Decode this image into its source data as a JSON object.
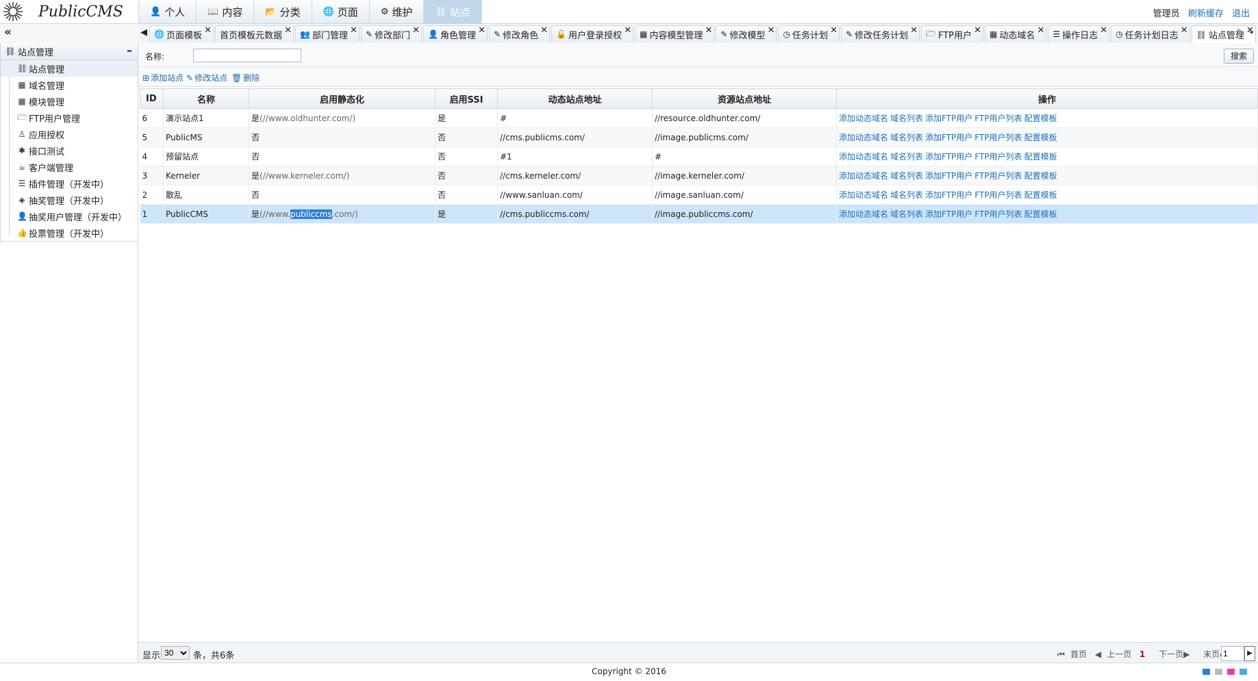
{
  "app": {
    "title": "PublicCMS"
  },
  "topnav": [
    {
      "label": "个人",
      "icon": "user-icon",
      "glyph": "👤"
    },
    {
      "label": "内容",
      "icon": "book-icon",
      "glyph": "📖"
    },
    {
      "label": "分类",
      "icon": "folder-open-icon",
      "glyph": "📂"
    },
    {
      "label": "页面",
      "icon": "globe-icon",
      "glyph": "🌐"
    },
    {
      "label": "维护",
      "icon": "gear-icon",
      "glyph": "⚙"
    },
    {
      "label": "站点",
      "icon": "sitemap-icon",
      "glyph": "⛓"
    }
  ],
  "userbar": {
    "user": "管理员",
    "refresh": "刷新缓存",
    "logout": "退出"
  },
  "sidebar": {
    "collapse": "«",
    "group": "站点管理",
    "items": [
      {
        "label": "站点管理",
        "icon": "sitemap-icon",
        "glyph": "⛓"
      },
      {
        "label": "域名管理",
        "icon": "qrcode-icon",
        "glyph": "▦"
      },
      {
        "label": "模块管理",
        "icon": "grid-icon",
        "glyph": "▦"
      },
      {
        "label": "FTP用户管理",
        "icon": "folder-icon",
        "glyph": "🗁"
      },
      {
        "label": "应用授权",
        "icon": "linux-icon",
        "glyph": "♙"
      },
      {
        "label": "接口测试",
        "icon": "bug-icon",
        "glyph": "✱"
      },
      {
        "label": "客户端管理",
        "icon": "coffee-icon",
        "glyph": "☕"
      },
      {
        "label": "插件管理（开发中）",
        "icon": "list-icon",
        "glyph": "☰"
      },
      {
        "label": "抽奖管理（开发中）",
        "icon": "ticket-icon",
        "glyph": "◈"
      },
      {
        "label": "抽奖用户管理（开发中）",
        "icon": "user-icon",
        "glyph": "👤"
      },
      {
        "label": "投票管理（开发中）",
        "icon": "thumbs-up-icon",
        "glyph": "👍"
      }
    ]
  },
  "tabs": [
    {
      "label": "页面模板",
      "icon": "globe-icon",
      "glyph": "🌐"
    },
    {
      "label": "首页模板元数据",
      "icon": "",
      "glyph": ""
    },
    {
      "label": "部门管理",
      "icon": "users-icon",
      "glyph": "👥"
    },
    {
      "label": "修改部门",
      "icon": "edit-icon",
      "glyph": "✎"
    },
    {
      "label": "角色管理",
      "icon": "user-secret-icon",
      "glyph": "👤"
    },
    {
      "label": "修改角色",
      "icon": "edit-icon",
      "glyph": "✎"
    },
    {
      "label": "用户登录授权",
      "icon": "unlock-icon",
      "glyph": "🔓"
    },
    {
      "label": "内容模型管理",
      "icon": "th-large-icon",
      "glyph": "▦"
    },
    {
      "label": "修改模型",
      "icon": "edit-icon",
      "glyph": "✎"
    },
    {
      "label": "任务计划",
      "icon": "clock-icon",
      "glyph": "◷"
    },
    {
      "label": "修改任务计划",
      "icon": "edit-icon",
      "glyph": "✎"
    },
    {
      "label": "FTP用户",
      "icon": "folder-icon",
      "glyph": "🗁"
    },
    {
      "label": "动态域名",
      "icon": "qrcode-icon",
      "glyph": "▦"
    },
    {
      "label": "操作日志",
      "icon": "list-alt-icon",
      "glyph": "☰"
    },
    {
      "label": "任务计划日志",
      "icon": "clock-icon",
      "glyph": "◷"
    },
    {
      "label": "站点管理",
      "icon": "sitemap-icon",
      "glyph": "⛓"
    }
  ],
  "search": {
    "label": "名称:",
    "value": "",
    "button": "搜索"
  },
  "toolbar": {
    "add": "添加站点",
    "edit": "修改站点",
    "delete": "删除"
  },
  "table": {
    "headers": [
      "ID",
      "名称",
      "启用静态化",
      "启用SSI",
      "动态站点地址",
      "资源站点地址",
      "操作"
    ],
    "ops": [
      "添加动态域名",
      "域名列表",
      "添加FTP用户",
      "FTP用户列表",
      "配置模板"
    ],
    "rows": [
      {
        "id": "6",
        "name": "演示站点1",
        "static": "是",
        "static_url": "(//www.oldhunter.com/)",
        "ssi": "是",
        "dynamic": "#",
        "resource": "//resource.oldhunter.com/"
      },
      {
        "id": "5",
        "name": "PublicMS",
        "static": "否",
        "static_url": "",
        "ssi": "否",
        "dynamic": "//cms.publicms.com/",
        "resource": "//image.publicms.com/"
      },
      {
        "id": "4",
        "name": "预留站点",
        "static": "否",
        "static_url": "",
        "ssi": "否",
        "dynamic": "#1",
        "resource": "#"
      },
      {
        "id": "3",
        "name": "Kerneler",
        "static": "是",
        "static_url": "(//www.kerneler.com/)",
        "ssi": "否",
        "dynamic": "//cms.kerneler.com/",
        "resource": "//image.kerneler.com/"
      },
      {
        "id": "2",
        "name": "散乱",
        "static": "否",
        "static_url": "",
        "ssi": "否",
        "dynamic": "//www.sanluan.com/",
        "resource": "//image.sanluan.com/"
      },
      {
        "id": "1",
        "name": "PublicCMS",
        "static": "是",
        "static_url_pre": "(//www.",
        "static_url_hl": "publiccms",
        "static_url_post": ".com/)",
        "ssi": "是",
        "dynamic": "//cms.publiccms.com/",
        "resource": "//image.publiccms.com/"
      }
    ]
  },
  "pager": {
    "show": "显示",
    "page_size": "30",
    "total": "条，共6条",
    "first": "首页",
    "prev": "上一页",
    "current": "1",
    "next": "下一页",
    "last": "末页",
    "goto": "1"
  },
  "footer": {
    "copyright": "Copyright © 2016"
  },
  "theme_colors": [
    "#2f7ed8",
    "#bbbbbb",
    "#e83fb8",
    "#49a9e0"
  ]
}
